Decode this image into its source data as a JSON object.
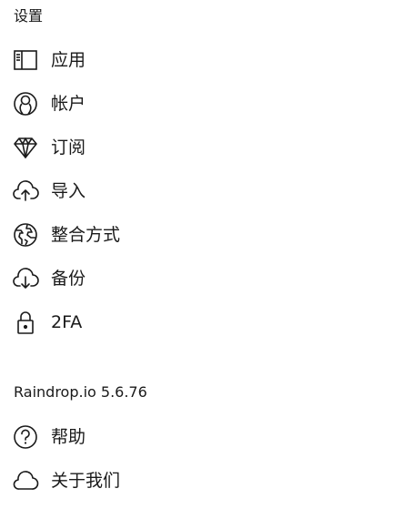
{
  "settings": {
    "title": "设置",
    "items": [
      {
        "label": "应用",
        "icon": "app-layout-icon"
      },
      {
        "label": "帐户",
        "icon": "account-icon"
      },
      {
        "label": "订阅",
        "icon": "diamond-icon"
      },
      {
        "label": "导入",
        "icon": "cloud-upload-icon"
      },
      {
        "label": "整合方式",
        "icon": "globe-icon"
      },
      {
        "label": "备份",
        "icon": "cloud-download-icon"
      },
      {
        "label": "2FA",
        "icon": "lock-icon"
      }
    ]
  },
  "about": {
    "version": "Raindrop.io 5.6.76",
    "items": [
      {
        "label": "帮助",
        "icon": "help-icon"
      },
      {
        "label": "关于我们",
        "icon": "cloud-icon"
      }
    ]
  }
}
